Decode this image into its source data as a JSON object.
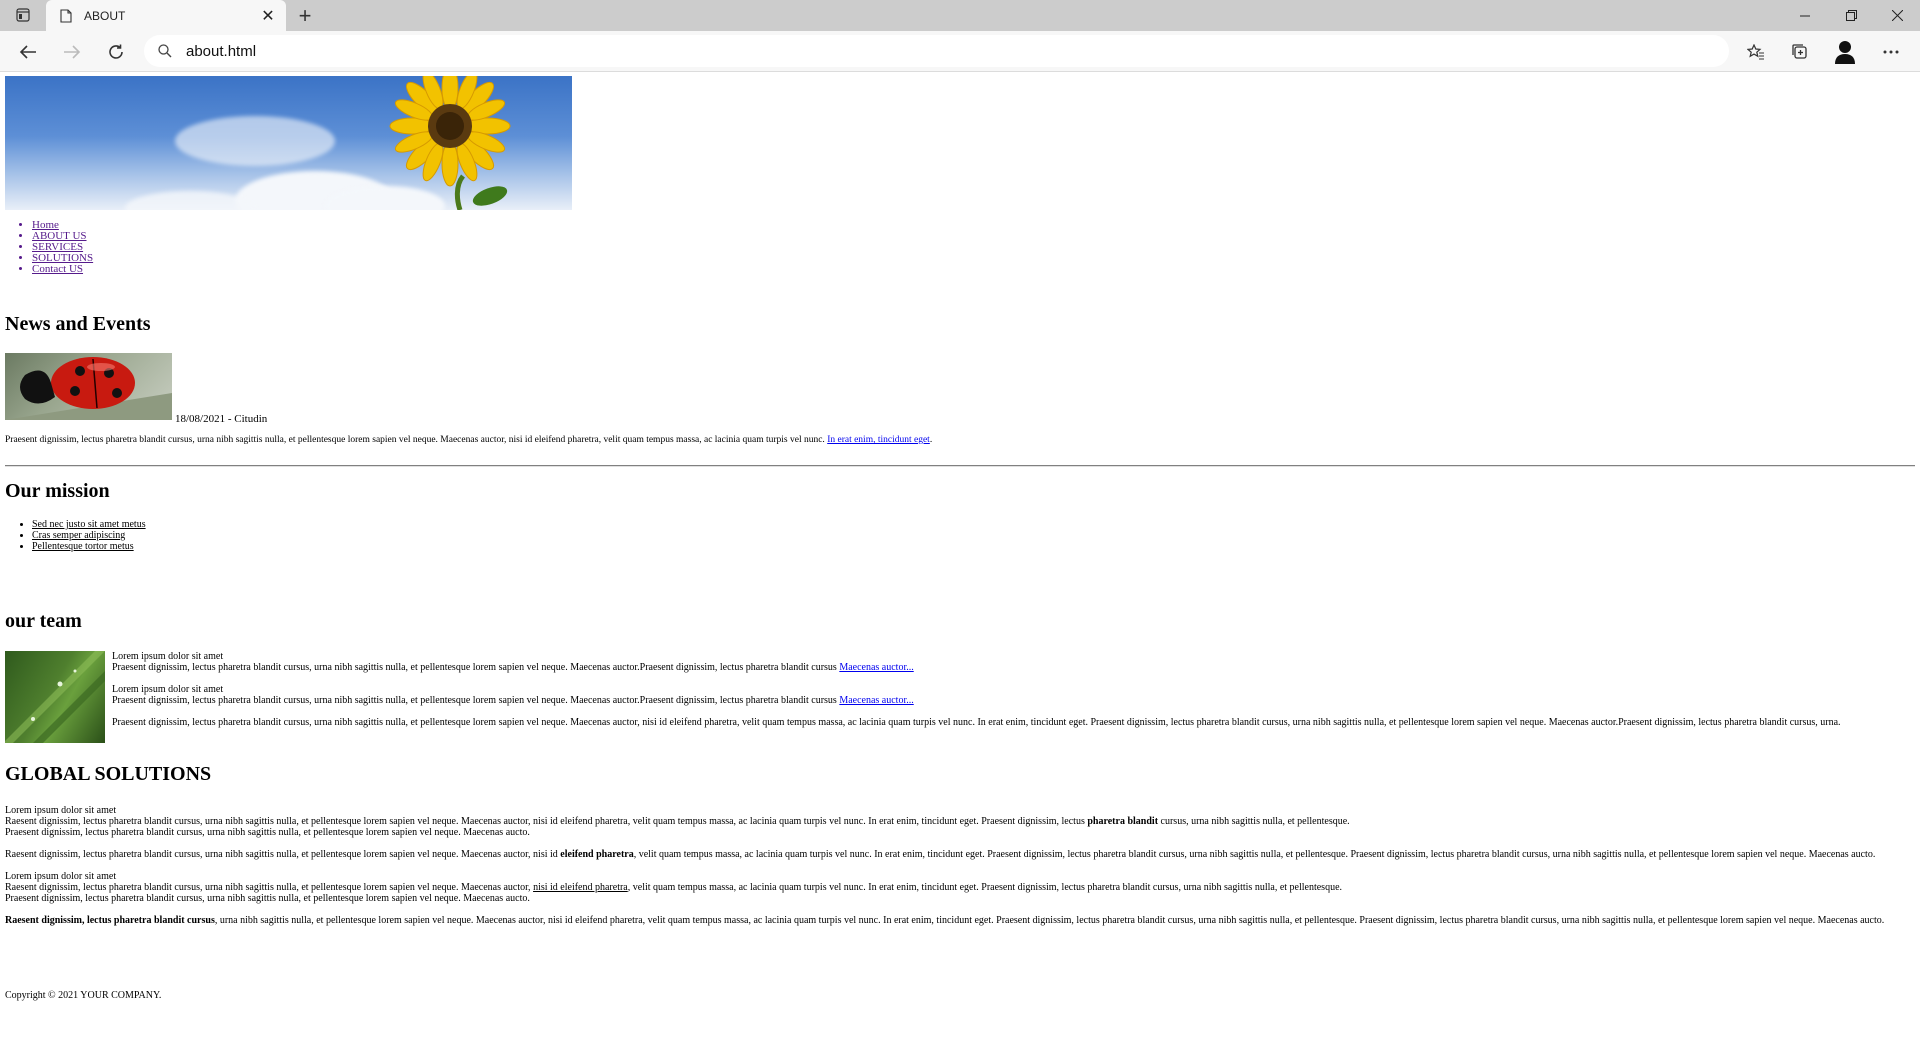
{
  "browser": {
    "tab_title": "ABOUT",
    "address": "about.html"
  },
  "nav": [
    "Home",
    "ABOUT US",
    "SERVICES",
    "SOLUTIONS",
    "Contact US"
  ],
  "news": {
    "heading": "News and Events",
    "date": "18/08/2021 - Citudin",
    "text": "Praesent dignissim, lectus pharetra blandit cursus, urna nibh sagittis nulla, et pellentesque lorem sapien vel neque. Maecenas auctor, nisi id eleifend pharetra, velit quam tempus massa, ac lacinia quam turpis vel nunc. ",
    "link": "In erat enim, tincidunt eget",
    "end": "."
  },
  "mission": {
    "heading": "Our mission",
    "items": [
      "Sed nec justo sit amet metus",
      "Cras semper adipiscing",
      "Pellentesque tortor metus"
    ]
  },
  "team": {
    "heading": "our team",
    "p1_title": "Lorem ipsum dolor sit amet",
    "p1_text": "Praesent dignissim, lectus pharetra blandit cursus, urna nibh sagittis nulla, et pellentesque lorem sapien vel neque. Maecenas auctor.Praesent dignissim, lectus pharetra blandit cursus ",
    "p1_link": "Maecenas auctor...",
    "p2_title": "Lorem ipsum dolor sit amet",
    "p2_text": "Praesent dignissim, lectus pharetra blandit cursus, urna nibh sagittis nulla, et pellentesque lorem sapien vel neque. Maecenas auctor.Praesent dignissim, lectus pharetra blandit cursus ",
    "p2_link": "Maecenas auctor...",
    "p3_text": "Praesent dignissim, lectus pharetra blandit cursus, urna nibh sagittis nulla, et pellentesque lorem sapien vel neque. Maecenas auctor, nisi id eleifend pharetra, velit quam tempus massa, ac lacinia quam turpis vel nunc. In erat enim, tincidunt eget. Praesent dignissim, lectus pharetra blandit cursus, urna nibh sagittis nulla, et pellentesque lorem sapien vel neque. Maecenas auctor.Praesent dignissim, lectus pharetra blandit cursus, urna."
  },
  "global": {
    "heading": "GLOBAL SOLUTIONS",
    "b1_title": "Lorem ipsum dolor sit amet",
    "b1_l1a": "Raesent dignissim, lectus pharetra blandit cursus, urna nibh sagittis nulla, et pellentesque lorem sapien vel neque. Maecenas auctor, nisi id eleifend pharetra, velit quam tempus massa, ac lacinia quam turpis vel nunc. In erat enim, tincidunt eget. Praesent dignissim, lectus ",
    "b1_l1b": "pharetra blandit",
    "b1_l1c": " cursus, urna nibh sagittis nulla, et pellentesque.",
    "b1_l2": "Praesent dignissim, lectus pharetra blandit cursus, urna nibh sagittis nulla, et pellentesque lorem sapien vel neque. Maecenas aucto.",
    "b2_a": "Raesent dignissim, lectus pharetra blandit cursus, urna nibh sagittis nulla, et pellentesque lorem sapien vel neque. Maecenas auctor, nisi id ",
    "b2_b": "eleifend pharetra",
    "b2_c": ", velit quam tempus massa, ac lacinia quam turpis vel nunc. In erat enim, tincidunt eget. Praesent dignissim, lectus pharetra blandit cursus, urna nibh sagittis nulla, et pellentesque. Praesent dignissim, lectus pharetra blandit cursus, urna nibh sagittis nulla, et pellentesque lorem sapien vel neque. Maecenas aucto.",
    "b3_title": "Lorem ipsum dolor sit amet",
    "b3_l1a": "Raesent dignissim, lectus pharetra blandit cursus, urna nibh sagittis nulla, et pellentesque lorem sapien vel neque. Maecenas auctor, ",
    "b3_l1b": "nisi id eleifend pharetra",
    "b3_l1c": ", velit quam tempus massa, ac lacinia quam turpis vel nunc. In erat enim, tincidunt eget. Praesent dignissim, lectus pharetra blandit cursus, urna nibh sagittis nulla, et pellentesque.",
    "b3_l2": "Praesent dignissim, lectus pharetra blandit cursus, urna nibh sagittis nulla, et pellentesque lorem sapien vel neque. Maecenas aucto.",
    "b4_a": "Raesent dignissim, lectus pharetra blandit cursus",
    "b4_b": ", urna nibh sagittis nulla, et pellentesque lorem sapien vel neque. Maecenas auctor, nisi id eleifend pharetra, velit quam tempus massa, ac lacinia quam turpis vel nunc. In erat enim, tincidunt eget. Praesent dignissim, lectus pharetra blandit cursus, urna nibh sagittis nulla, et pellentesque. Praesent dignissim, lectus pharetra blandit cursus, urna nibh sagittis nulla, et pellentesque lorem sapien vel neque. Maecenas aucto."
  },
  "footer": "Copyright © 2021 YOUR COMPANY."
}
